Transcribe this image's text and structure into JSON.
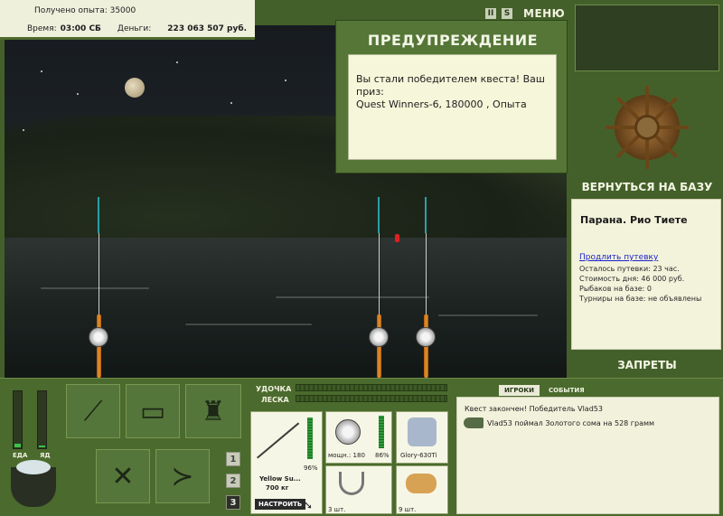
{
  "top_info": {
    "xp_label": "Получено опыта: 35000",
    "time_label": "Время:",
    "time_value": "03:00 СБ",
    "money_label": "Деньги:",
    "money_value": "223 063 507 руб."
  },
  "top_buttons": {
    "pause": "II",
    "sound": "S",
    "menu": "МЕНЮ"
  },
  "warning": {
    "title": "ПРЕДУПРЕЖДЕНИЕ",
    "message_line1": "Вы стали победителем квеста! Ваш приз:",
    "message_line2": "Quest Winners-6, 180000 , Опыта"
  },
  "right_panel": {
    "return_button": "ВЕРНУТЬСЯ НА БАЗУ",
    "location": "Парана. Рио Тиете",
    "extend_link": "Продлить путевку",
    "lines": [
      "Осталось путевки: 23 час.",
      "Стоимость дня: 46 000 руб.",
      "Рыбаков на базе: 0",
      "Турниры на базе: не объявлены"
    ],
    "bans_button": "ЗАПРЕТЫ"
  },
  "status": {
    "food_label": "ЕДА",
    "poison_label": "ЯД",
    "food_level": 0.05,
    "poison_level": 0.03
  },
  "pages": [
    "1",
    "2",
    "3"
  ],
  "tackle": {
    "rod_label": "УДОЧКА",
    "line_label": "ЛЕСКА",
    "rod_name": "Yellow Su...",
    "rod_weight": "700 кг",
    "rod_condition": "96%",
    "setup_button": "НАСТРОИТЬ",
    "reel_power": "мощн.: 180",
    "reel_condition": "86%",
    "line_name": "Glory-630Ti",
    "hook_count": "3 шт.",
    "bait_count": "9 шт."
  },
  "chat": {
    "tab_players": "ИГРОКИ",
    "tab_events": "СОБЫТИЯ",
    "messages": [
      "Квест закончен! Победитель Vlad53",
      "Vlad53 поймал Золотого сома на 528 грамм"
    ]
  }
}
